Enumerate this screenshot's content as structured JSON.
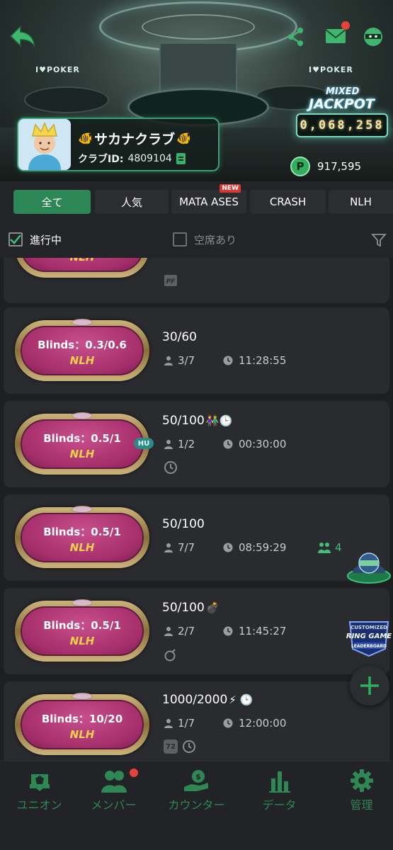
{
  "header": {
    "club_name": "サカナクラブ",
    "club_id_label": "クラブID:",
    "club_id": "4809104",
    "jackpot_mixed": "MIXED",
    "jackpot_title": "JACKPOT",
    "jackpot_value": "0,068,258",
    "points": "917,595",
    "points_icon": "P",
    "poker_sign": "I♥POKER"
  },
  "tabs": [
    {
      "label": "全て",
      "active": true
    },
    {
      "label": "人気"
    },
    {
      "label": "MATA ASES",
      "badge": "NEW"
    },
    {
      "label": "CRASH"
    },
    {
      "label": "NLH"
    }
  ],
  "filters": {
    "in_progress": "進行中",
    "in_progress_checked": true,
    "seats_available": "空席あり",
    "seats_available_checked": false
  },
  "tables": [
    {
      "blinds": "",
      "game": "NLH",
      "tag": "PF"
    },
    {
      "blinds": "Blinds：0.3/0.6",
      "game": "NLH",
      "stake": "30/60",
      "emoji": "",
      "players": "3/7",
      "time": "11:28:55"
    },
    {
      "blinds": "Blinds：0.5/1",
      "game": "NLH",
      "stake": "50/100",
      "emoji": "👫🕒",
      "players": "1/2",
      "time": "00:30:00",
      "hu": "HU"
    },
    {
      "blinds": "Blinds：0.5/1",
      "game": "NLH",
      "stake": "50/100",
      "emoji": "",
      "players": "7/7",
      "time": "08:59:29",
      "waiting": "4"
    },
    {
      "blinds": "Blinds：0.5/1",
      "game": "NLH",
      "stake": "50/100",
      "emoji": "💣",
      "players": "2/7",
      "time": "11:45:27"
    },
    {
      "blinds": "Blinds：10/20",
      "game": "NLH",
      "stake": "1000/2000",
      "emoji": "⚡ 🕒",
      "players": "1/7",
      "time": "12:00:00",
      "tag": "72"
    }
  ],
  "leaderboard": {
    "line1": "CUSTOMIZED",
    "line2": "RING GAME",
    "line3": "LEADERBOARD"
  },
  "nav": [
    {
      "label": "ユニオン",
      "icon": "union-badge-icon"
    },
    {
      "label": "メンバー",
      "icon": "members-icon"
    },
    {
      "label": "カウンター",
      "icon": "counter-icon"
    },
    {
      "label": "データ",
      "icon": "data-chart-icon"
    },
    {
      "label": "管理",
      "icon": "gear-icon"
    }
  ],
  "colors": {
    "accent_green": "#2d8656",
    "nav_green": "#2f8754",
    "felt_pink": "#a52f6b",
    "game_yellow": "#f2d14a",
    "badge_red": "#d63a34"
  }
}
